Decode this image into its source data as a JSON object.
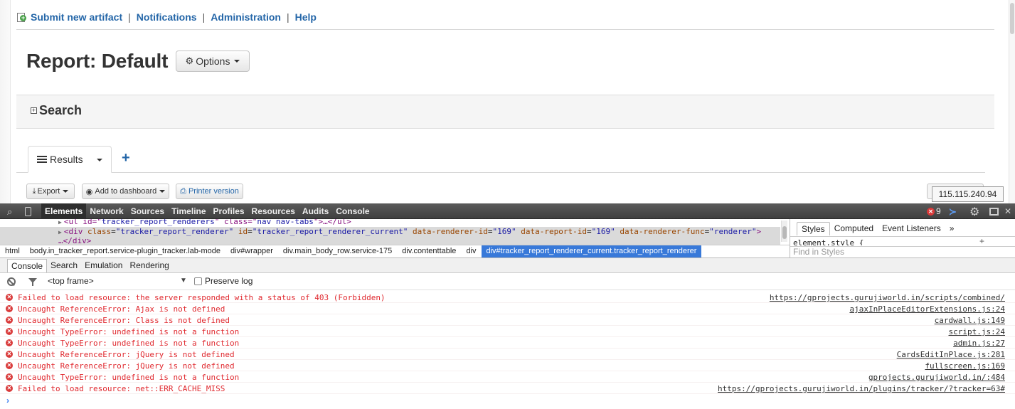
{
  "topnav": {
    "submit": "Submit new artifact",
    "notifications": "Notifications",
    "administration": "Administration",
    "help": "Help",
    "separator": "|"
  },
  "report": {
    "title": "Report: Default",
    "options_label": "Options"
  },
  "search": {
    "title": "Search",
    "toggle": "+"
  },
  "tabs": {
    "results_label": "Results",
    "add_label": "+"
  },
  "toolbar": {
    "export_label": "Export",
    "dashboard_label": "Add to dashboard",
    "printer_label": "Printer version"
  },
  "tooltip": {
    "ip": "115.115.240.94"
  },
  "devtools": {
    "tabs": [
      "Elements",
      "Network",
      "Sources",
      "Timeline",
      "Profiles",
      "Resources",
      "Audits",
      "Console"
    ],
    "error_count": "9",
    "elements": {
      "line1": {
        "prefix": "<ul id=\"",
        "id": "tracker_report_renderers",
        "mid": "\" class=\"",
        "class": "nav nav-tabs",
        "suffix": "\">…</ul>"
      },
      "line2": {
        "open": "<div",
        "a1": "class",
        "v1": "\"tracker_report_renderer\"",
        "a2": "id",
        "v2": "\"tracker_report_renderer_current\"",
        "a3": "data-renderer-id",
        "v3": "\"169\"",
        "a4": "data-report-id",
        "v4": "\"169\"",
        "a5": "data-renderer-func",
        "v5": "\"renderer\"",
        "close": ">"
      },
      "line3": "…</div>"
    },
    "breadcrumbs": [
      "html",
      "body.in_tracker_report.service-plugin_tracker.lab-mode",
      "div#wrapper",
      "div.main_body_row.service-175",
      "div.contenttable",
      "div",
      "div#tracker_report_renderer_current.tracker_report_renderer"
    ],
    "styles": {
      "tabs": [
        "Styles",
        "Computed",
        "Event Listeners",
        "»"
      ],
      "element_style": "element.style {",
      "find_placeholder": "Find in Styles"
    },
    "drawer_tabs": [
      "Console",
      "Search",
      "Emulation",
      "Rendering"
    ],
    "console": {
      "frame": "<top frame>",
      "preserve_log": "Preserve log",
      "messages": [
        {
          "text": "Failed to load resource: the server responded with a status of 403 (Forbidden)",
          "source": "https://gprojects.gurujiworld.in/scripts/combined/"
        },
        {
          "text": "Uncaught ReferenceError: Ajax is not defined",
          "source": "ajaxInPlaceEditorExtensions.js:24"
        },
        {
          "text": "Uncaught ReferenceError: Class is not defined",
          "source": "cardwall.js:149"
        },
        {
          "text": "Uncaught TypeError: undefined is not a function",
          "source": "script.js:24"
        },
        {
          "text": "Uncaught TypeError: undefined is not a function",
          "source": "admin.js:27"
        },
        {
          "text": "Uncaught ReferenceError: jQuery is not defined",
          "source": "CardsEditInPlace.js:281"
        },
        {
          "text": "Uncaught ReferenceError: jQuery is not defined",
          "source": "fullscreen.js:169"
        },
        {
          "text": "Uncaught TypeError: undefined is not a function",
          "source": "gprojects.gurujiworld.in/:484"
        },
        {
          "text": "Failed to load resource: net::ERR_CACHE_MISS",
          "source": "https://gprojects.gurujiworld.in/plugins/tracker/?tracker=63#"
        }
      ],
      "prompt": "›"
    }
  }
}
